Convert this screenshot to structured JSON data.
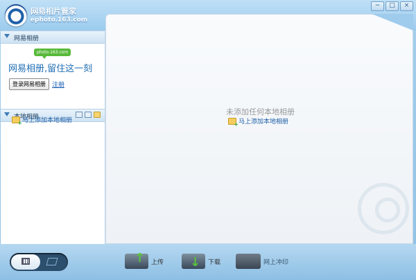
{
  "app": {
    "title": "网易相片管家",
    "domain": "ephoto.163.com"
  },
  "window_controls": {
    "minimize": "−",
    "maximize": "□",
    "close": "×"
  },
  "toolbar_icons": [
    "lock-icon",
    "gear-icon",
    "arrow-down-icon"
  ],
  "netease_section": {
    "title": "网易相册",
    "bubble": "photo.163.com",
    "slogan": "网易相册,留住这一刻",
    "login_label": "登录网易相册",
    "register_label": "注册"
  },
  "local_section": {
    "title": "本地相册",
    "add_link": "马上添加本地相册"
  },
  "main": {
    "empty_message": "未添加任何本地相册",
    "add_link": "马上添加本地相册"
  },
  "actions": {
    "upload": "上传",
    "download": "下载",
    "print": "网上冲印"
  },
  "colors": {
    "accent": "#1f6eb4",
    "brand_green": "#58b93a",
    "frame": "#9fcbed"
  }
}
